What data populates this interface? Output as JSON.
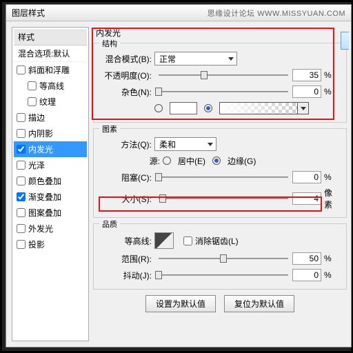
{
  "titlebar": {
    "title": "图层样式",
    "watermark": "思缘设计论坛 WWW.MISSYUAN.COM"
  },
  "sidebar": {
    "header": "样式",
    "subheader": "混合选项:默认",
    "items": [
      {
        "label": "斜面和浮雕",
        "checked": false,
        "indent": 0
      },
      {
        "label": "等高线",
        "checked": false,
        "indent": 1
      },
      {
        "label": "纹理",
        "checked": false,
        "indent": 1
      },
      {
        "label": "描边",
        "checked": false,
        "indent": 0
      },
      {
        "label": "内阴影",
        "checked": false,
        "indent": 0
      },
      {
        "label": "内发光",
        "checked": true,
        "indent": 0,
        "selected": true
      },
      {
        "label": "光泽",
        "checked": false,
        "indent": 0
      },
      {
        "label": "颜色叠加",
        "checked": false,
        "indent": 0
      },
      {
        "label": "渐变叠加",
        "checked": true,
        "indent": 0
      },
      {
        "label": "图案叠加",
        "checked": false,
        "indent": 0
      },
      {
        "label": "外发光",
        "checked": false,
        "indent": 0
      },
      {
        "label": "投影",
        "checked": false,
        "indent": 0
      }
    ]
  },
  "main": {
    "title": "内发光",
    "struct": {
      "label": "结构",
      "blend_label": "混合模式(B):",
      "blend_value": "正常",
      "opacity_label": "不透明度(O):",
      "opacity_value": "35",
      "opacity_unit": "%",
      "noise_label": "杂色(N):",
      "noise_value": "0",
      "noise_unit": "%"
    },
    "elements": {
      "label": "图素",
      "method_label": "方法(Q):",
      "method_value": "柔和",
      "source_label": "源:",
      "source_center": "居中(E)",
      "source_edge": "边缘(G)",
      "choke_label": "阻塞(C):",
      "choke_value": "0",
      "choke_unit": "%",
      "size_label": "大小(S):",
      "size_value": "4",
      "size_unit": "像素"
    },
    "quality": {
      "label": "品质",
      "contour_label": "等高线:",
      "antialias_label": "消除锯齿(L)",
      "range_label": "范围(R):",
      "range_value": "50",
      "range_unit": "%",
      "jitter_label": "抖动(J):",
      "jitter_value": "0",
      "jitter_unit": "%"
    },
    "buttons": {
      "default": "设置为默认值",
      "reset": "复位为默认值"
    }
  }
}
